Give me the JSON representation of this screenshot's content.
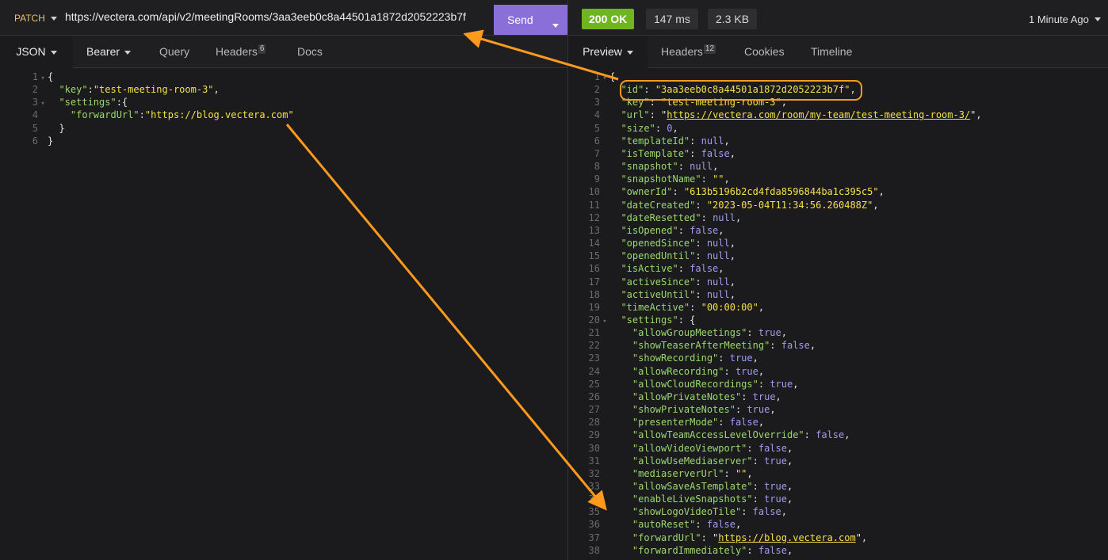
{
  "request": {
    "method": "PATCH",
    "url": "https://vectera.com/api/v2/meetingRooms/3aa3eeb0c8a44501a1872d2052223b7f",
    "send_label": "Send"
  },
  "response_meta": {
    "status": "200 OK",
    "time": "147 ms",
    "size": "2.3 KB",
    "ago": "1 Minute Ago"
  },
  "left_tabs": [
    {
      "label": "JSON"
    },
    {
      "label": "Bearer"
    },
    {
      "label": "Query"
    },
    {
      "label": "Headers",
      "badge": "6"
    },
    {
      "label": "Docs"
    }
  ],
  "right_tabs": [
    {
      "label": "Preview"
    },
    {
      "label": "Headers",
      "badge": "12"
    },
    {
      "label": "Cookies"
    },
    {
      "label": "Timeline"
    }
  ],
  "request_body": [
    {
      "n": "1",
      "fold": "▾",
      "parts": [
        {
          "t": "p",
          "v": "{"
        }
      ]
    },
    {
      "n": "2",
      "parts": [
        {
          "t": "p",
          "v": "  "
        },
        {
          "t": "k",
          "v": "\"key\""
        },
        {
          "t": "p",
          "v": ":"
        },
        {
          "t": "s",
          "v": "\"test-meeting-room-3\""
        },
        {
          "t": "p",
          "v": ","
        }
      ]
    },
    {
      "n": "3",
      "fold": "▾",
      "parts": [
        {
          "t": "p",
          "v": "  "
        },
        {
          "t": "k",
          "v": "\"settings\""
        },
        {
          "t": "p",
          "v": ":{"
        }
      ]
    },
    {
      "n": "4",
      "parts": [
        {
          "t": "p",
          "v": "    "
        },
        {
          "t": "k",
          "v": "\"forwardUrl\""
        },
        {
          "t": "p",
          "v": ":"
        },
        {
          "t": "s",
          "v": "\"https://blog.vectera.com\""
        }
      ]
    },
    {
      "n": "5",
      "parts": [
        {
          "t": "p",
          "v": "  }"
        }
      ]
    },
    {
      "n": "6",
      "parts": [
        {
          "t": "p",
          "v": "}"
        }
      ]
    }
  ],
  "response_body": [
    {
      "n": "1",
      "fold": "▾",
      "parts": [
        {
          "t": "p",
          "v": "{"
        }
      ]
    },
    {
      "n": "2",
      "parts": [
        {
          "t": "p",
          "v": "  "
        },
        {
          "t": "k",
          "v": "\"id\""
        },
        {
          "t": "p",
          "v": ": "
        },
        {
          "t": "s",
          "v": "\"3aa3eeb0c8a44501a1872d2052223b7f\""
        },
        {
          "t": "p",
          "v": ","
        }
      ]
    },
    {
      "n": "3",
      "parts": [
        {
          "t": "p",
          "v": "  "
        },
        {
          "t": "k",
          "v": "\"key\""
        },
        {
          "t": "p",
          "v": ": "
        },
        {
          "t": "s",
          "v": "\"test-meeting-room-3\""
        },
        {
          "t": "p",
          "v": ","
        }
      ]
    },
    {
      "n": "4",
      "parts": [
        {
          "t": "p",
          "v": "  "
        },
        {
          "t": "k",
          "v": "\"url\""
        },
        {
          "t": "p",
          "v": ": \""
        },
        {
          "t": "u",
          "v": "https://vectera.com/room/my-team/test-meeting-room-3/"
        },
        {
          "t": "p",
          "v": "\","
        }
      ]
    },
    {
      "n": "5",
      "parts": [
        {
          "t": "p",
          "v": "  "
        },
        {
          "t": "k",
          "v": "\"size\""
        },
        {
          "t": "p",
          "v": ": "
        },
        {
          "t": "n",
          "v": "0"
        },
        {
          "t": "p",
          "v": ","
        }
      ]
    },
    {
      "n": "6",
      "parts": [
        {
          "t": "p",
          "v": "  "
        },
        {
          "t": "k",
          "v": "\"templateId\""
        },
        {
          "t": "p",
          "v": ": "
        },
        {
          "t": "n",
          "v": "null"
        },
        {
          "t": "p",
          "v": ","
        }
      ]
    },
    {
      "n": "7",
      "parts": [
        {
          "t": "p",
          "v": "  "
        },
        {
          "t": "k",
          "v": "\"isTemplate\""
        },
        {
          "t": "p",
          "v": ": "
        },
        {
          "t": "n",
          "v": "false"
        },
        {
          "t": "p",
          "v": ","
        }
      ]
    },
    {
      "n": "8",
      "parts": [
        {
          "t": "p",
          "v": "  "
        },
        {
          "t": "k",
          "v": "\"snapshot\""
        },
        {
          "t": "p",
          "v": ": "
        },
        {
          "t": "n",
          "v": "null"
        },
        {
          "t": "p",
          "v": ","
        }
      ]
    },
    {
      "n": "9",
      "parts": [
        {
          "t": "p",
          "v": "  "
        },
        {
          "t": "k",
          "v": "\"snapshotName\""
        },
        {
          "t": "p",
          "v": ": "
        },
        {
          "t": "s",
          "v": "\"\""
        },
        {
          "t": "p",
          "v": ","
        }
      ]
    },
    {
      "n": "10",
      "parts": [
        {
          "t": "p",
          "v": "  "
        },
        {
          "t": "k",
          "v": "\"ownerId\""
        },
        {
          "t": "p",
          "v": ": "
        },
        {
          "t": "s",
          "v": "\"613b5196b2cd4fda8596844ba1c395c5\""
        },
        {
          "t": "p",
          "v": ","
        }
      ]
    },
    {
      "n": "11",
      "parts": [
        {
          "t": "p",
          "v": "  "
        },
        {
          "t": "k",
          "v": "\"dateCreated\""
        },
        {
          "t": "p",
          "v": ": "
        },
        {
          "t": "s",
          "v": "\"2023-05-04T11:34:56.260488Z\""
        },
        {
          "t": "p",
          "v": ","
        }
      ]
    },
    {
      "n": "12",
      "parts": [
        {
          "t": "p",
          "v": "  "
        },
        {
          "t": "k",
          "v": "\"dateResetted\""
        },
        {
          "t": "p",
          "v": ": "
        },
        {
          "t": "n",
          "v": "null"
        },
        {
          "t": "p",
          "v": ","
        }
      ]
    },
    {
      "n": "13",
      "parts": [
        {
          "t": "p",
          "v": "  "
        },
        {
          "t": "k",
          "v": "\"isOpened\""
        },
        {
          "t": "p",
          "v": ": "
        },
        {
          "t": "n",
          "v": "false"
        },
        {
          "t": "p",
          "v": ","
        }
      ]
    },
    {
      "n": "14",
      "parts": [
        {
          "t": "p",
          "v": "  "
        },
        {
          "t": "k",
          "v": "\"openedSince\""
        },
        {
          "t": "p",
          "v": ": "
        },
        {
          "t": "n",
          "v": "null"
        },
        {
          "t": "p",
          "v": ","
        }
      ]
    },
    {
      "n": "15",
      "parts": [
        {
          "t": "p",
          "v": "  "
        },
        {
          "t": "k",
          "v": "\"openedUntil\""
        },
        {
          "t": "p",
          "v": ": "
        },
        {
          "t": "n",
          "v": "null"
        },
        {
          "t": "p",
          "v": ","
        }
      ]
    },
    {
      "n": "16",
      "parts": [
        {
          "t": "p",
          "v": "  "
        },
        {
          "t": "k",
          "v": "\"isActive\""
        },
        {
          "t": "p",
          "v": ": "
        },
        {
          "t": "n",
          "v": "false"
        },
        {
          "t": "p",
          "v": ","
        }
      ]
    },
    {
      "n": "17",
      "parts": [
        {
          "t": "p",
          "v": "  "
        },
        {
          "t": "k",
          "v": "\"activeSince\""
        },
        {
          "t": "p",
          "v": ": "
        },
        {
          "t": "n",
          "v": "null"
        },
        {
          "t": "p",
          "v": ","
        }
      ]
    },
    {
      "n": "18",
      "parts": [
        {
          "t": "p",
          "v": "  "
        },
        {
          "t": "k",
          "v": "\"activeUntil\""
        },
        {
          "t": "p",
          "v": ": "
        },
        {
          "t": "n",
          "v": "null"
        },
        {
          "t": "p",
          "v": ","
        }
      ]
    },
    {
      "n": "19",
      "parts": [
        {
          "t": "p",
          "v": "  "
        },
        {
          "t": "k",
          "v": "\"timeActive\""
        },
        {
          "t": "p",
          "v": ": "
        },
        {
          "t": "s",
          "v": "\"00:00:00\""
        },
        {
          "t": "p",
          "v": ","
        }
      ]
    },
    {
      "n": "20",
      "fold": "▾",
      "parts": [
        {
          "t": "p",
          "v": "  "
        },
        {
          "t": "k",
          "v": "\"settings\""
        },
        {
          "t": "p",
          "v": ": {"
        }
      ]
    },
    {
      "n": "21",
      "parts": [
        {
          "t": "p",
          "v": "    "
        },
        {
          "t": "k",
          "v": "\"allowGroupMeetings\""
        },
        {
          "t": "p",
          "v": ": "
        },
        {
          "t": "n",
          "v": "true"
        },
        {
          "t": "p",
          "v": ","
        }
      ]
    },
    {
      "n": "22",
      "parts": [
        {
          "t": "p",
          "v": "    "
        },
        {
          "t": "k",
          "v": "\"showTeaserAfterMeeting\""
        },
        {
          "t": "p",
          "v": ": "
        },
        {
          "t": "n",
          "v": "false"
        },
        {
          "t": "p",
          "v": ","
        }
      ]
    },
    {
      "n": "23",
      "parts": [
        {
          "t": "p",
          "v": "    "
        },
        {
          "t": "k",
          "v": "\"showRecording\""
        },
        {
          "t": "p",
          "v": ": "
        },
        {
          "t": "n",
          "v": "true"
        },
        {
          "t": "p",
          "v": ","
        }
      ]
    },
    {
      "n": "24",
      "parts": [
        {
          "t": "p",
          "v": "    "
        },
        {
          "t": "k",
          "v": "\"allowRecording\""
        },
        {
          "t": "p",
          "v": ": "
        },
        {
          "t": "n",
          "v": "true"
        },
        {
          "t": "p",
          "v": ","
        }
      ]
    },
    {
      "n": "25",
      "parts": [
        {
          "t": "p",
          "v": "    "
        },
        {
          "t": "k",
          "v": "\"allowCloudRecordings\""
        },
        {
          "t": "p",
          "v": ": "
        },
        {
          "t": "n",
          "v": "true"
        },
        {
          "t": "p",
          "v": ","
        }
      ]
    },
    {
      "n": "26",
      "parts": [
        {
          "t": "p",
          "v": "    "
        },
        {
          "t": "k",
          "v": "\"allowPrivateNotes\""
        },
        {
          "t": "p",
          "v": ": "
        },
        {
          "t": "n",
          "v": "true"
        },
        {
          "t": "p",
          "v": ","
        }
      ]
    },
    {
      "n": "27",
      "parts": [
        {
          "t": "p",
          "v": "    "
        },
        {
          "t": "k",
          "v": "\"showPrivateNotes\""
        },
        {
          "t": "p",
          "v": ": "
        },
        {
          "t": "n",
          "v": "true"
        },
        {
          "t": "p",
          "v": ","
        }
      ]
    },
    {
      "n": "28",
      "parts": [
        {
          "t": "p",
          "v": "    "
        },
        {
          "t": "k",
          "v": "\"presenterMode\""
        },
        {
          "t": "p",
          "v": ": "
        },
        {
          "t": "n",
          "v": "false"
        },
        {
          "t": "p",
          "v": ","
        }
      ]
    },
    {
      "n": "29",
      "parts": [
        {
          "t": "p",
          "v": "    "
        },
        {
          "t": "k",
          "v": "\"allowTeamAccessLevelOverride\""
        },
        {
          "t": "p",
          "v": ": "
        },
        {
          "t": "n",
          "v": "false"
        },
        {
          "t": "p",
          "v": ","
        }
      ]
    },
    {
      "n": "30",
      "parts": [
        {
          "t": "p",
          "v": "    "
        },
        {
          "t": "k",
          "v": "\"allowVideoViewport\""
        },
        {
          "t": "p",
          "v": ": "
        },
        {
          "t": "n",
          "v": "false"
        },
        {
          "t": "p",
          "v": ","
        }
      ]
    },
    {
      "n": "31",
      "parts": [
        {
          "t": "p",
          "v": "    "
        },
        {
          "t": "k",
          "v": "\"allowUseMediaserver\""
        },
        {
          "t": "p",
          "v": ": "
        },
        {
          "t": "n",
          "v": "true"
        },
        {
          "t": "p",
          "v": ","
        }
      ]
    },
    {
      "n": "32",
      "parts": [
        {
          "t": "p",
          "v": "    "
        },
        {
          "t": "k",
          "v": "\"mediaserverUrl\""
        },
        {
          "t": "p",
          "v": ": "
        },
        {
          "t": "s",
          "v": "\"\""
        },
        {
          "t": "p",
          "v": ","
        }
      ]
    },
    {
      "n": "33",
      "parts": [
        {
          "t": "p",
          "v": "    "
        },
        {
          "t": "k",
          "v": "\"allowSaveAsTemplate\""
        },
        {
          "t": "p",
          "v": ": "
        },
        {
          "t": "n",
          "v": "true"
        },
        {
          "t": "p",
          "v": ","
        }
      ]
    },
    {
      "n": "34",
      "parts": [
        {
          "t": "p",
          "v": "    "
        },
        {
          "t": "k",
          "v": "\"enableLiveSnapshots\""
        },
        {
          "t": "p",
          "v": ": "
        },
        {
          "t": "n",
          "v": "true"
        },
        {
          "t": "p",
          "v": ","
        }
      ]
    },
    {
      "n": "35",
      "parts": [
        {
          "t": "p",
          "v": "    "
        },
        {
          "t": "k",
          "v": "\"showLogoVideoTile\""
        },
        {
          "t": "p",
          "v": ": "
        },
        {
          "t": "n",
          "v": "false"
        },
        {
          "t": "p",
          "v": ","
        }
      ]
    },
    {
      "n": "36",
      "parts": [
        {
          "t": "p",
          "v": "    "
        },
        {
          "t": "k",
          "v": "\"autoReset\""
        },
        {
          "t": "p",
          "v": ": "
        },
        {
          "t": "n",
          "v": "false"
        },
        {
          "t": "p",
          "v": ","
        }
      ]
    },
    {
      "n": "37",
      "parts": [
        {
          "t": "p",
          "v": "    "
        },
        {
          "t": "k",
          "v": "\"forwardUrl\""
        },
        {
          "t": "p",
          "v": ": \""
        },
        {
          "t": "u",
          "v": "https://blog.vectera.com"
        },
        {
          "t": "p",
          "v": "\","
        }
      ]
    },
    {
      "n": "38",
      "parts": [
        {
          "t": "p",
          "v": "    "
        },
        {
          "t": "k",
          "v": "\"forwardImmediately\""
        },
        {
          "t": "p",
          "v": ": "
        },
        {
          "t": "n",
          "v": "false"
        },
        {
          "t": "p",
          "v": ","
        }
      ]
    }
  ],
  "colors": {
    "accent": "#8a6fd9",
    "status_ok": "#6fb51f",
    "annotation": "#ff9a1e",
    "json_key": "#9bd86c",
    "json_string": "#f3e04b",
    "json_literal": "#a29cf0"
  },
  "icons": {
    "dropdown": "chevron-down-icon",
    "fold": "fold-triangle-icon"
  }
}
